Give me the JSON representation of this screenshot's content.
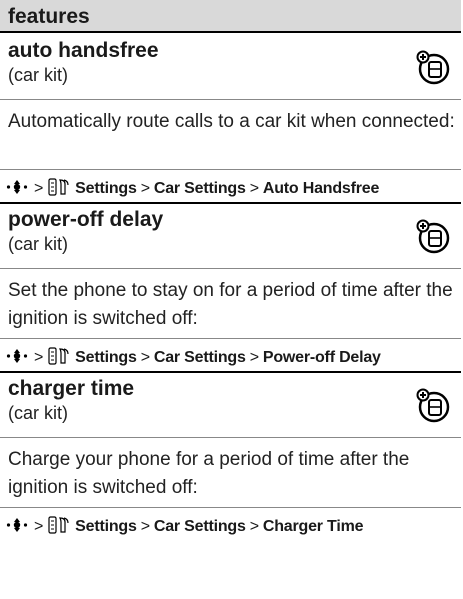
{
  "header": {
    "title": "features"
  },
  "path_labels": {
    "settings": "Settings",
    "car_settings": "Car Settings",
    "separator": ">"
  },
  "sections": [
    {
      "title": "auto handsfree",
      "subtitle": "(car kit)",
      "body": "Automatically route calls to a car kit when connected:",
      "final_item": "Auto Handsfree",
      "icon": "network-feature-icon"
    },
    {
      "title": "power-off delay",
      "subtitle": "(car kit)",
      "body": "Set the phone to stay on for a period of time after the ignition is switched off:",
      "final_item": "Power-off Delay",
      "icon": "network-feature-icon"
    },
    {
      "title": "charger time",
      "subtitle": "(car kit)",
      "body": "Charge your phone for a period of time after the ignition is switched off:",
      "final_item": "Charger Time",
      "icon": "network-feature-icon"
    }
  ]
}
